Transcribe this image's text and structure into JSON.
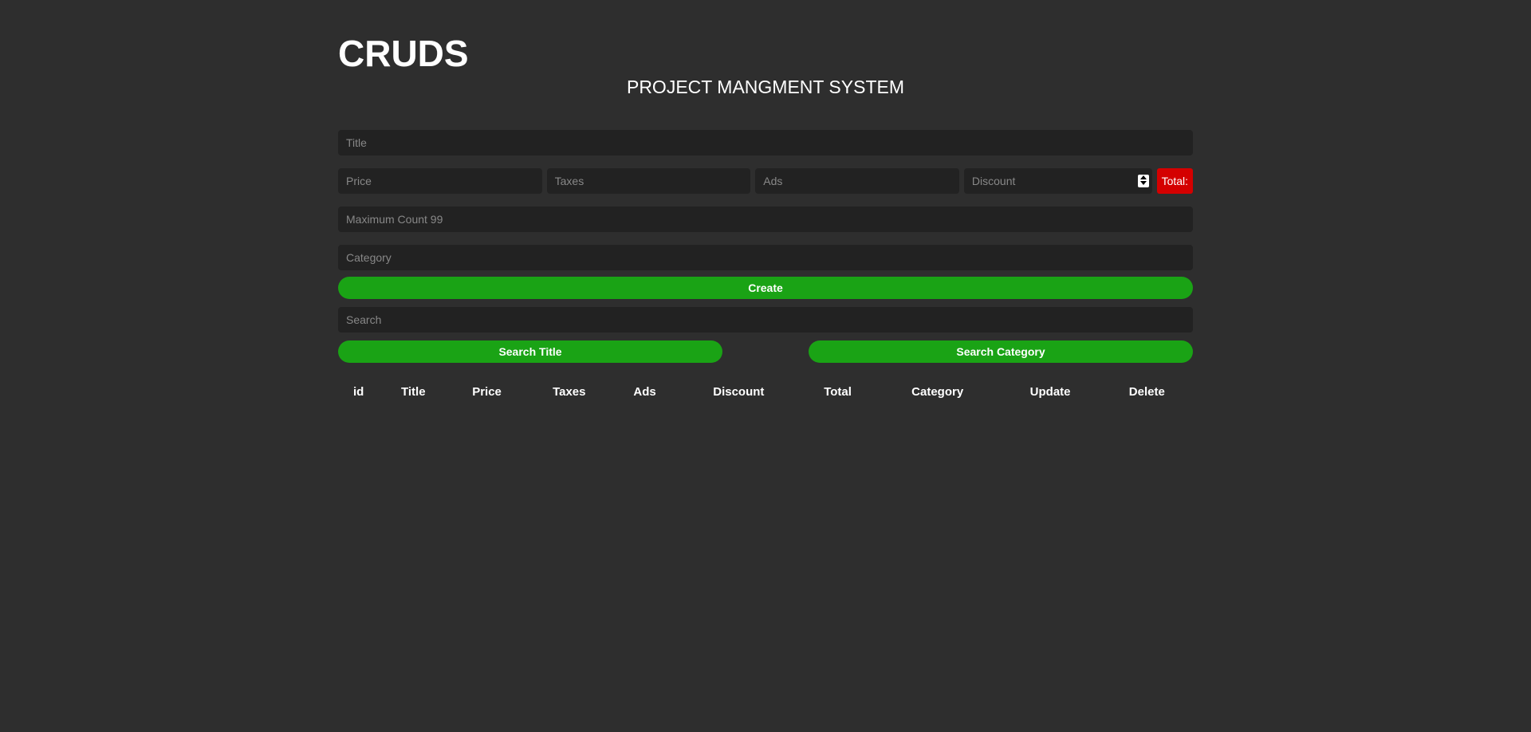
{
  "header": {
    "title": "CRUDS",
    "subtitle": "PROJECT MANGMENT SYSTEM"
  },
  "inputs": {
    "title_placeholder": "Title",
    "price_placeholder": "Price",
    "taxes_placeholder": "Taxes",
    "ads_placeholder": "Ads",
    "discount_placeholder": "Discount",
    "count_placeholder": "Maximum Count 99",
    "category_placeholder": "Category",
    "search_placeholder": "Search"
  },
  "total": {
    "label": "Total:"
  },
  "buttons": {
    "create": "Create",
    "search_title": "Search Title",
    "search_category": "Search Category"
  },
  "table": {
    "headers": [
      "id",
      "Title",
      "Price",
      "Taxes",
      "Ads",
      "Discount",
      "Total",
      "Category",
      "Update",
      "Delete"
    ]
  }
}
